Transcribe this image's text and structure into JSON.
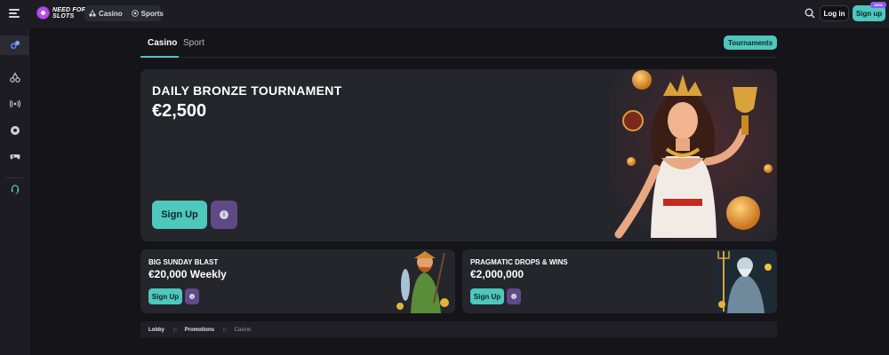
{
  "header": {
    "logo_text_line1": "NEED FOR",
    "logo_text_line2": "SLOTS",
    "modes": [
      {
        "label": "Casino",
        "icon": "cherries-icon"
      },
      {
        "label": "Sports",
        "icon": "soccer-ball-icon"
      }
    ],
    "login_label": "Log in",
    "signup_label": "Sign up",
    "signup_badge": "100%"
  },
  "sidebar": {
    "items": [
      {
        "icon": "casino-promo-icon",
        "active": true
      },
      {
        "icon": "cherries-icon"
      },
      {
        "icon": "live-broadcast-icon"
      },
      {
        "icon": "soccer-ball-icon"
      },
      {
        "icon": "gamepad-icon"
      },
      {
        "icon": "support-headset-icon"
      }
    ]
  },
  "tabs": [
    {
      "label": "Casino",
      "active": true
    },
    {
      "label": "Sport",
      "active": false
    }
  ],
  "tournaments_label": "Tournaments",
  "hero": {
    "title": "DAILY BRONZE TOURNAMENT",
    "amount": "€2,500",
    "signup_label": "Sign Up",
    "info_glyph": "i"
  },
  "promos": [
    {
      "title": "BIG SUNDAY BLAST",
      "amount": "€20,000 Weekly",
      "signup_label": "Sign Up",
      "info_glyph": "i"
    },
    {
      "title": "PRAGMATIC DROPS & WINS",
      "amount": "€2,000,000",
      "signup_label": "Sign Up",
      "info_glyph": "i"
    }
  ],
  "breadcrumb": {
    "items": [
      "Lobby",
      "Promotions",
      "Casino"
    ],
    "separator": "▷"
  },
  "colors": {
    "accent": "#4ec7bc",
    "info_button": "#5d4a86",
    "card_bg": "#25252c",
    "page_bg": "#141419"
  }
}
